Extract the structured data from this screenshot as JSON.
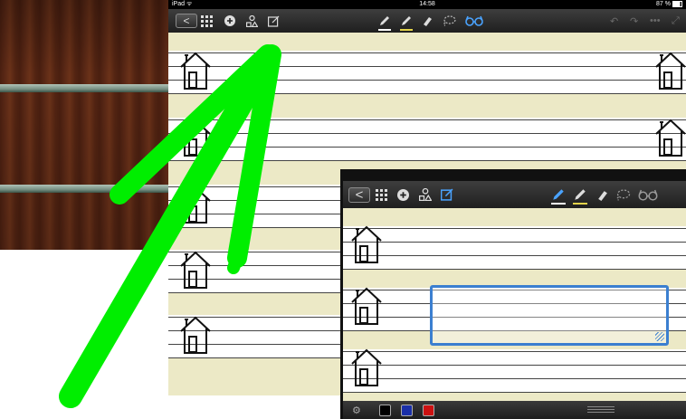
{
  "status_bar": {
    "device": "iPad",
    "time": "14:58",
    "battery": "87 %"
  },
  "main_toolbar": {
    "back_label": "<",
    "left_icons": [
      "grid-icon",
      "plus-circle-icon",
      "shapes-icon",
      "edit-text-icon"
    ],
    "tool_icons": [
      "pen-icon",
      "highlighter-icon",
      "eraser-icon",
      "lasso-icon",
      "view-glasses-icon"
    ],
    "right_icons": [
      "undo-icon",
      "redo-icon",
      "more-icon",
      "expand-icon"
    ]
  },
  "inset_toolbar": {
    "back_label": "<",
    "left_icons": [
      "grid-icon",
      "plus-circle-icon",
      "shapes-icon",
      "edit-text-icon"
    ],
    "tool_icons": [
      "pen-icon",
      "highlighter-icon",
      "eraser-icon",
      "lasso-icon",
      "view-glasses-icon"
    ]
  },
  "color_swatches": [
    "#000000",
    "#1a2fa8",
    "#cc1111"
  ],
  "colors": {
    "accent_blue": "#3b7fd0",
    "arrow_green": "#00ee00",
    "paper": "#ece9c6"
  }
}
